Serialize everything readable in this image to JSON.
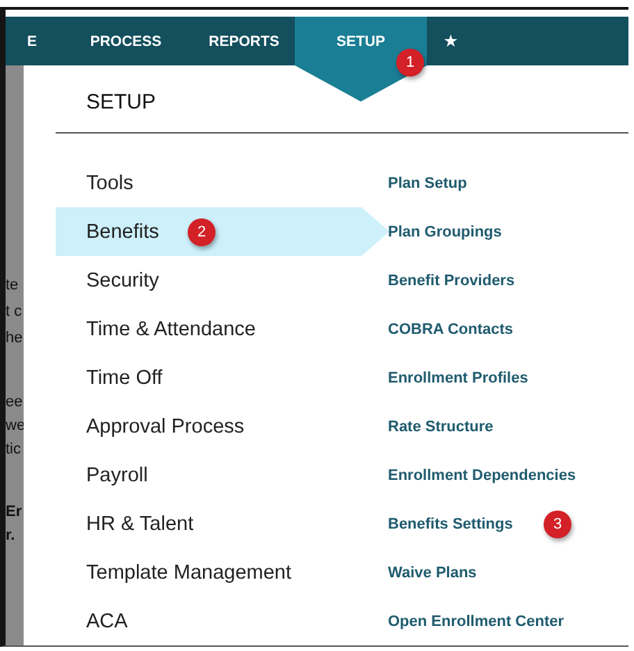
{
  "nav": {
    "tabs": [
      {
        "label": "E",
        "selected": false
      },
      {
        "label": "PROCESS",
        "selected": false
      },
      {
        "label": "REPORTS",
        "selected": false
      },
      {
        "label": "SETUP",
        "selected": true,
        "badge": "1"
      },
      {
        "label": "★",
        "selected": false
      }
    ]
  },
  "background_fragments": [
    "te",
    "t c",
    "he",
    "ee",
    "we",
    "tic",
    "Er",
    "r."
  ],
  "menu": {
    "title": "SETUP",
    "categories": [
      {
        "label": "Tools",
        "selected": false
      },
      {
        "label": "Benefits",
        "selected": true,
        "badge": "2"
      },
      {
        "label": "Security",
        "selected": false
      },
      {
        "label": "Time & Attendance",
        "selected": false
      },
      {
        "label": "Time Off",
        "selected": false
      },
      {
        "label": "Approval Process",
        "selected": false
      },
      {
        "label": "Payroll",
        "selected": false
      },
      {
        "label": "HR & Talent",
        "selected": false
      },
      {
        "label": "Template Management",
        "selected": false
      },
      {
        "label": "ACA",
        "selected": false
      }
    ],
    "links": [
      {
        "label": "Plan Setup"
      },
      {
        "label": "Plan Groupings"
      },
      {
        "label": "Benefit Providers"
      },
      {
        "label": "COBRA Contacts"
      },
      {
        "label": "Enrollment Profiles"
      },
      {
        "label": "Rate Structure"
      },
      {
        "label": "Enrollment Dependencies"
      },
      {
        "label": "Benefits Settings",
        "badge": "3"
      },
      {
        "label": "Waive Plans"
      },
      {
        "label": "Open Enrollment Center"
      }
    ]
  }
}
